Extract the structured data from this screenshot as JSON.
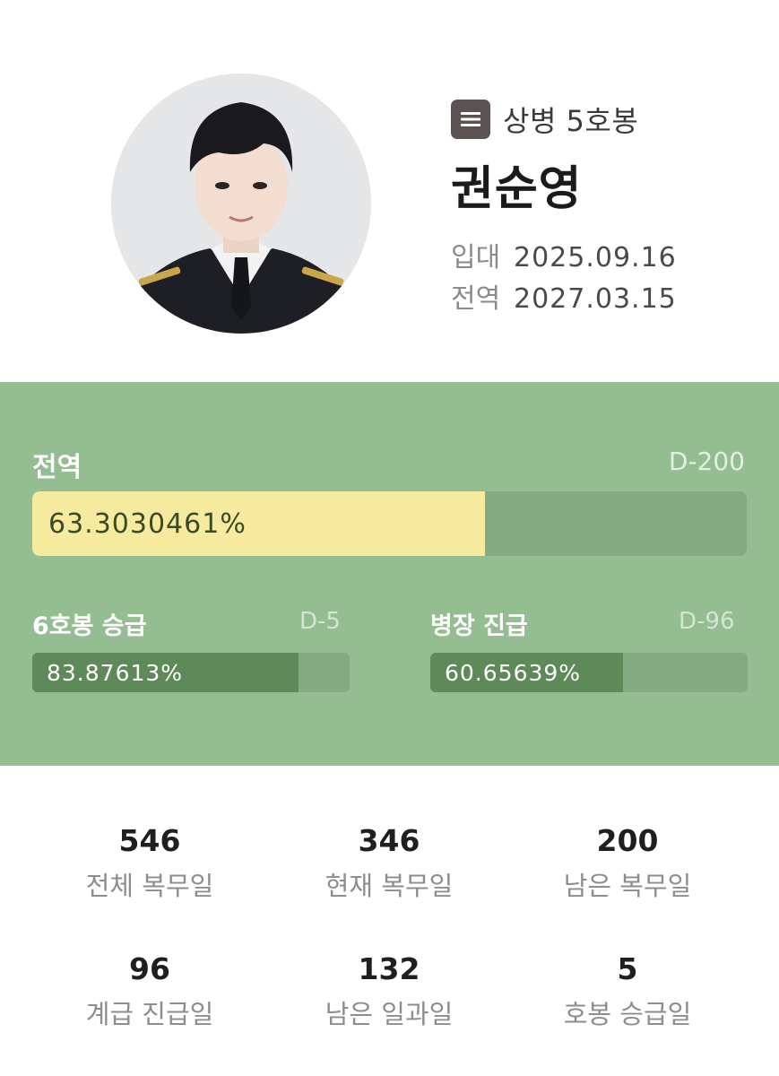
{
  "profile": {
    "rank": "상병 5호봉",
    "rank_icon": "list-icon",
    "name": "권순영",
    "enlist_label": "입대",
    "enlist_date": "2025.09.16",
    "discharge_label": "전역",
    "discharge_date": "2027.03.15"
  },
  "progress": {
    "main": {
      "title": "전역",
      "dday": "D-200",
      "percent_text": "63.3030461%",
      "fraction": 0.633030461
    },
    "left": {
      "title": "6호봉 승급",
      "dday": "D-5",
      "percent_text": "83.87613%",
      "fraction": 0.8387613
    },
    "right": {
      "title": "병장 진급",
      "dday": "D-96",
      "percent_text": "60.65639%",
      "fraction": 0.6065639
    }
  },
  "stats": [
    {
      "value": "546",
      "label": "전체 복무일"
    },
    {
      "value": "346",
      "label": "현재 복무일"
    },
    {
      "value": "200",
      "label": "남은 복무일"
    },
    {
      "value": "96",
      "label": "계급 진급일"
    },
    {
      "value": "132",
      "label": "남은 일과일"
    },
    {
      "value": "5",
      "label": "호봉 승급일"
    }
  ],
  "colors": {
    "panel": "#94bd92",
    "main_fill": "#f6ea9f",
    "sub_fill": "#5d8a58",
    "track": "#84aa82"
  }
}
